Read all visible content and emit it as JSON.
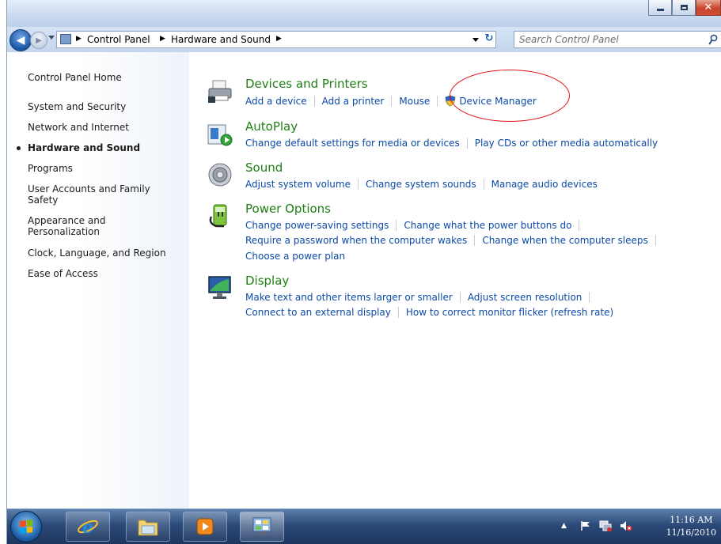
{
  "address_bar": {
    "breadcrumbs": [
      "Control Panel",
      "Hardware and Sound"
    ],
    "search_placeholder": "Search Control Panel"
  },
  "sidebar": {
    "items": [
      {
        "label": "Control Panel Home"
      },
      {
        "label": "System and Security"
      },
      {
        "label": "Network and Internet"
      },
      {
        "label": "Hardware and Sound",
        "active": true
      },
      {
        "label": "Programs"
      },
      {
        "label": "User Accounts and Family Safety"
      },
      {
        "label": "Appearance and Personalization"
      },
      {
        "label": "Clock, Language, and Region"
      },
      {
        "label": "Ease of Access"
      }
    ]
  },
  "categories": [
    {
      "title": "Devices and Printers",
      "icon": "printer-icon",
      "links": [
        [
          "Add a device",
          "Add a printer",
          "Mouse",
          "Device Manager"
        ]
      ]
    },
    {
      "title": "AutoPlay",
      "icon": "autoplay-icon",
      "links": [
        [
          "Change default settings for media or devices",
          "Play CDs or other media automatically"
        ]
      ]
    },
    {
      "title": "Sound",
      "icon": "speaker-icon",
      "links": [
        [
          "Adjust system volume",
          "Change system sounds",
          "Manage audio devices"
        ]
      ]
    },
    {
      "title": "Power Options",
      "icon": "power-plug-icon",
      "links": [
        [
          "Change power-saving settings",
          "Change what the power buttons do"
        ],
        [
          "Require a password when the computer wakes",
          "Change when the computer sleeps"
        ],
        [
          "Choose a power plan"
        ]
      ]
    },
    {
      "title": "Display",
      "icon": "monitor-icon",
      "links": [
        [
          "Make text and other items larger or smaller",
          "Adjust screen resolution"
        ],
        [
          "Connect to an external display",
          "How to correct monitor flicker (refresh rate)"
        ]
      ]
    }
  ],
  "taskbar": {
    "clock_time": "11:16 AM",
    "clock_date": "11/16/2010"
  },
  "colors": {
    "link": "#0c4aa6",
    "category_title": "#1e7f13",
    "highlight_ring": "#e0101b"
  }
}
